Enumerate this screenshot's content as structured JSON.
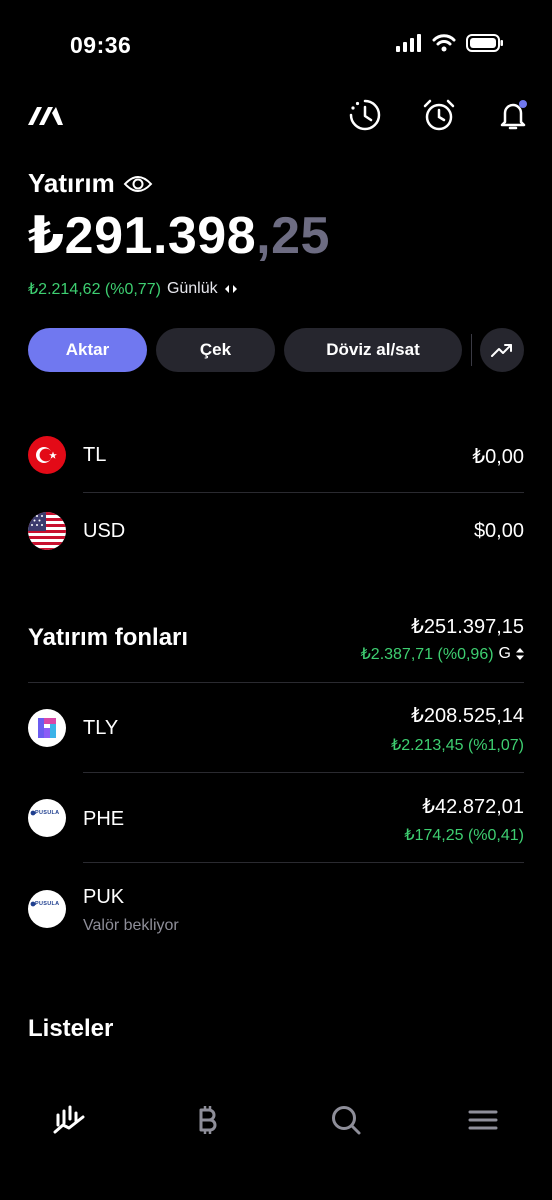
{
  "status_bar": {
    "time": "09:36"
  },
  "header": {
    "logo_icon": "brand-logo-icon",
    "icons": [
      "history-icon",
      "alarm-clock-icon",
      "notification-bell-icon"
    ],
    "notification_dot_color": "#7078f0"
  },
  "balance": {
    "label": "Yatırım",
    "amount_main": "₺291.398",
    "amount_decimal": ",25",
    "daily_change": "₺2.214,62 (%0,77)",
    "daily_label": "Günlük"
  },
  "actions": {
    "transfer": "Aktar",
    "withdraw": "Çek",
    "fx": "Döviz al/sat",
    "chart_icon": "trend-up-icon"
  },
  "currencies": [
    {
      "code": "TL",
      "value": "₺0,00",
      "flag": "turkey-flag-icon"
    },
    {
      "code": "USD",
      "value": "$0,00",
      "flag": "usa-flag-icon"
    }
  ],
  "funds": {
    "title": "Yatırım fonları",
    "total": "₺251.397,15",
    "total_change": "₺2.387,71 (%0,96)",
    "period": "G",
    "items": [
      {
        "code": "TLY",
        "value": "₺208.525,14",
        "change": "₺2.213,45 (%1,07)"
      },
      {
        "code": "PHE",
        "value": "₺42.872,01",
        "change": "₺174,25 (%0,41)"
      },
      {
        "code": "PUK",
        "status": "Valör bekliyor"
      }
    ],
    "pusula_logo_text": "PUSULA"
  },
  "lists": {
    "title": "Listeler"
  },
  "tab_bar": [
    "portfolio-chart-icon",
    "bitcoin-icon",
    "search-icon",
    "menu-icon"
  ],
  "colors": {
    "accent": "#7078f0",
    "positive": "#3ecf71",
    "background": "#000000",
    "surface": "#26262e"
  }
}
